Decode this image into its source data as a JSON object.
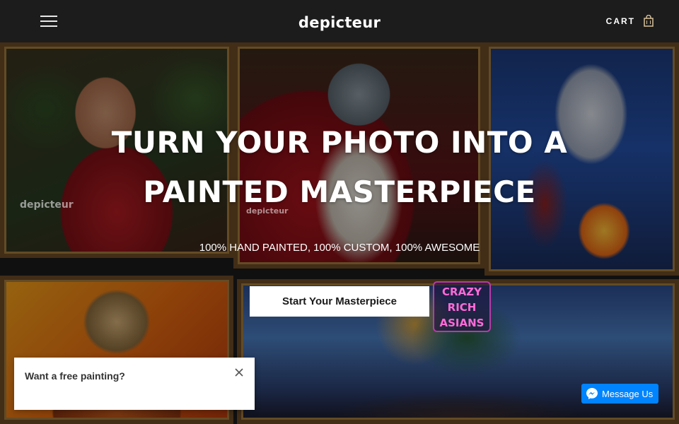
{
  "header": {
    "logo": "depicteur",
    "cart_label": "CART",
    "icons": {
      "menu": "hamburger-menu-icon",
      "cart": "shopping-bag-icon"
    }
  },
  "hero": {
    "title_line1": "TURN YOUR PHOTO INTO A",
    "title_line2": "PAINTED MASTERPIECE",
    "subtitle": "100% HAND PAINTED, 100% CUSTOM, 100% AWESOME",
    "cta_label": "Start Your Masterpiece",
    "watermark": "depicteur",
    "sign_lines": [
      "CRAZY",
      "RICH",
      "ASIANS"
    ]
  },
  "popup": {
    "text": "Want a free painting?",
    "close_icon": "close-icon"
  },
  "messenger": {
    "label": "Message Us",
    "icon": "messenger-icon",
    "color": "#0084ff"
  },
  "colors": {
    "header_bg": "#1c1c1c",
    "cta_bg": "#ffffff",
    "text_light": "#ffffff"
  }
}
